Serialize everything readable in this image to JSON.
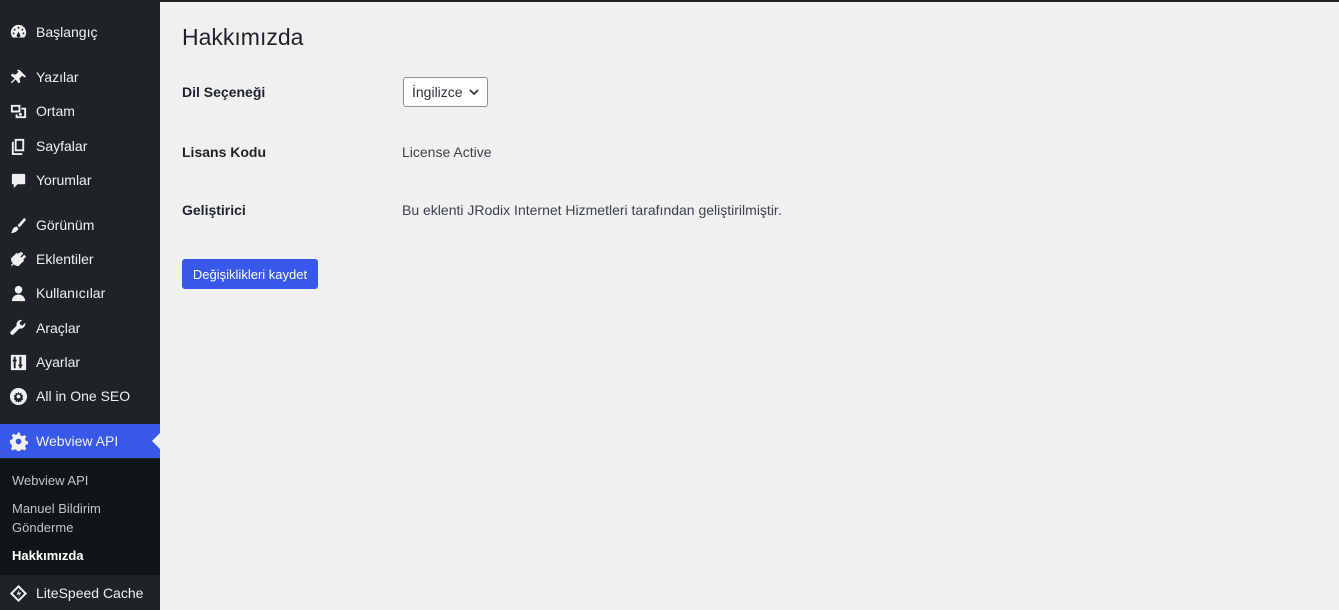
{
  "sidebar": {
    "items": [
      {
        "label": "Başlangıç",
        "icon": "dashboard-icon"
      },
      {
        "label": "Yazılar",
        "icon": "pin-icon"
      },
      {
        "label": "Ortam",
        "icon": "media-icon"
      },
      {
        "label": "Sayfalar",
        "icon": "pages-icon"
      },
      {
        "label": "Yorumlar",
        "icon": "comment-icon"
      },
      {
        "label": "Görünüm",
        "icon": "brush-icon"
      },
      {
        "label": "Eklentiler",
        "icon": "plugin-icon"
      },
      {
        "label": "Kullanıcılar",
        "icon": "user-icon"
      },
      {
        "label": "Araçlar",
        "icon": "wrench-icon"
      },
      {
        "label": "Ayarlar",
        "icon": "settings-sliders-icon"
      },
      {
        "label": "All in One SEO",
        "icon": "aioseo-icon"
      },
      {
        "label": "Webview API",
        "icon": "gear-icon"
      },
      {
        "label": "LiteSpeed Cache",
        "icon": "litespeed-icon"
      }
    ],
    "submenu": [
      {
        "label": "Webview API"
      },
      {
        "label": "Manuel Bildirim Gönderme"
      },
      {
        "label": "Hakkımızda"
      }
    ]
  },
  "page": {
    "title": "Hakkımızda",
    "language_label": "Dil Seçeneği",
    "language_value": "İngilizce",
    "license_label": "Lisans Kodu",
    "license_value": "License Active",
    "developer_label": "Geliştirici",
    "developer_value": "Bu eklenti JRodix Internet Hizmetleri tarafından geliştirilmiştir.",
    "save_label": "Değişiklikleri kaydet"
  },
  "colors": {
    "sidebar_bg": "#1d2327",
    "accent": "#3858e9",
    "content_bg": "#f0f0f1"
  }
}
